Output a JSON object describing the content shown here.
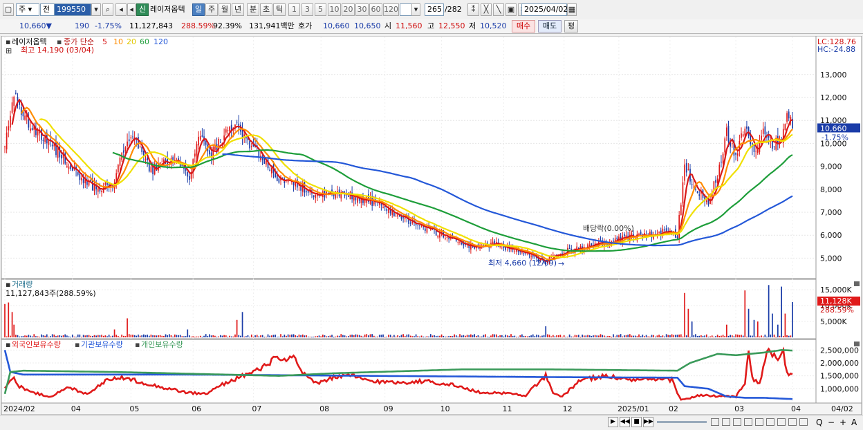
{
  "toolbar": {
    "market_label": "주",
    "compare_label": "전",
    "code_value": "199550",
    "badge_new": "신",
    "stock_name": "레이저옵텍",
    "periods": [
      "일",
      "주",
      "월",
      "년",
      "분",
      "초",
      "틱"
    ],
    "selected_period": "일",
    "intervals": [
      "1",
      "3",
      "5",
      "10",
      "20",
      "30",
      "60",
      "120"
    ],
    "count_value": "265",
    "count_total": "/282",
    "date_value": "2025/04/02"
  },
  "quote": {
    "price": "10,660",
    "arrow": "▼",
    "change": "190",
    "change_pct": "-1.75%",
    "volume": "11,127,843",
    "vol_ratio": "288.59%",
    "turnover": "92.39%",
    "amount": "131,941백만",
    "ask_label": "호가",
    "ask_price": "10,660",
    "bid_price": "10,650",
    "open_label": "시",
    "open_price": "11,560",
    "high_label": "고",
    "high_price": "12,550",
    "low_label": "저",
    "low_price": "10,520",
    "buy_label": "매수",
    "sell_label": "매도",
    "eval_label": "평"
  },
  "chart_data": {
    "type": "candlestick",
    "price_panel": {
      "title": "레이저옵텍",
      "ma_label": "종가 단순",
      "ma_periods": [
        "5",
        "10",
        "20",
        "60",
        "120"
      ],
      "ma_colors": [
        "#d81818",
        "#ff8c00",
        "#f0e000",
        "#1e9e3a",
        "#2458d8"
      ],
      "high_note": "최고 14,190 (03/04)",
      "low_note": "최저 4,660 (12/09)",
      "dividend_note": "배당락(0.00%)",
      "lc_label": "LC:128.76",
      "hc_label": "HC:-24.88",
      "y_ticks": [
        5000,
        6000,
        7000,
        8000,
        9000,
        10000,
        11000,
        12000,
        13000
      ],
      "y_tick_labels": [
        "5,000",
        "6,000",
        "7,000",
        "8,000",
        "9,000",
        "10,000",
        "11,000",
        "12,000",
        "13,000"
      ],
      "ylim": [
        4200,
        14500
      ],
      "current_price_label": "10,660",
      "current_change_label": "-1.75%",
      "current_price": 10660,
      "close_anchors": [
        [
          0,
          9800
        ],
        [
          5,
          12300
        ],
        [
          10,
          11200
        ],
        [
          20,
          10300
        ],
        [
          30,
          9600
        ],
        [
          40,
          8600
        ],
        [
          50,
          8000
        ],
        [
          60,
          8300
        ],
        [
          67,
          10300
        ],
        [
          72,
          10000
        ],
        [
          80,
          8800
        ],
        [
          88,
          9300
        ],
        [
          95,
          9000
        ],
        [
          101,
          8600
        ],
        [
          107,
          10400
        ],
        [
          112,
          9400
        ],
        [
          120,
          10300
        ],
        [
          127,
          10700
        ],
        [
          131,
          10200
        ],
        [
          136,
          9900
        ],
        [
          145,
          8900
        ],
        [
          152,
          8300
        ],
        [
          160,
          8200
        ],
        [
          172,
          7700
        ],
        [
          180,
          7800
        ],
        [
          190,
          7700
        ],
        [
          200,
          7500
        ],
        [
          215,
          6900
        ],
        [
          230,
          6300
        ],
        [
          240,
          6000
        ],
        [
          255,
          5500
        ],
        [
          270,
          5600
        ],
        [
          285,
          5200
        ],
        [
          295,
          4800
        ],
        [
          305,
          5300
        ],
        [
          315,
          5400
        ],
        [
          325,
          5600
        ],
        [
          335,
          5800
        ],
        [
          345,
          6000
        ],
        [
          355,
          6000
        ],
        [
          362,
          6200
        ],
        [
          368,
          6000
        ],
        [
          372,
          9000
        ],
        [
          378,
          8000
        ],
        [
          385,
          7500
        ],
        [
          390,
          8600
        ],
        [
          395,
          10500
        ],
        [
          400,
          9500
        ],
        [
          405,
          10800
        ],
        [
          410,
          9600
        ],
        [
          415,
          10500
        ],
        [
          420,
          10000
        ],
        [
          425,
          10300
        ],
        [
          429,
          11300
        ],
        [
          431,
          10660
        ]
      ],
      "n_days": 432,
      "seed": 199550
    },
    "volume_panel": {
      "title": "거래량",
      "current_label": "11,127,843주(288.59%)",
      "y_ticks": [
        5000000,
        10000000,
        15000000
      ],
      "y_tick_labels": [
        "5,000K",
        "10,000K",
        "15,000K"
      ],
      "ylim": [
        0,
        17000000
      ],
      "current_badge": "11,128K",
      "current_pct": "288.59%",
      "spikes": [
        [
          0,
          10500000
        ],
        [
          2,
          11000000
        ],
        [
          4,
          8000000
        ],
        [
          5,
          4000000
        ],
        [
          60,
          2500000
        ],
        [
          67,
          6000000
        ],
        [
          100,
          2500000
        ],
        [
          127,
          5500000
        ],
        [
          130,
          8000000
        ],
        [
          296,
          3500000
        ],
        [
          372,
          14000000
        ],
        [
          374,
          9000000
        ],
        [
          376,
          5000000
        ],
        [
          395,
          4000000
        ],
        [
          405,
          14800000
        ],
        [
          407,
          9000000
        ],
        [
          410,
          5500000
        ],
        [
          412,
          5000000
        ],
        [
          418,
          16500000
        ],
        [
          420,
          7500000
        ],
        [
          423,
          4000000
        ],
        [
          425,
          16000000
        ],
        [
          427,
          7500000
        ],
        [
          431,
          11127843
        ]
      ]
    },
    "holding_panel": {
      "series": [
        {
          "name": "외국인보유수량",
          "color": "#e01a1a",
          "points": [
            [
              0,
              1000000
            ],
            [
              4,
              1450000
            ],
            [
              8,
              1100000
            ],
            [
              15,
              850000
            ],
            [
              25,
              700000
            ],
            [
              35,
              1050000
            ],
            [
              45,
              800000
            ],
            [
              55,
              1300000
            ],
            [
              60,
              1450000
            ],
            [
              70,
              1350000
            ],
            [
              80,
              1150000
            ],
            [
              90,
              1000000
            ],
            [
              100,
              850000
            ],
            [
              110,
              800000
            ],
            [
              120,
              1200000
            ],
            [
              130,
              1500000
            ],
            [
              140,
              1750000
            ],
            [
              148,
              2200000
            ],
            [
              152,
              2050000
            ],
            [
              158,
              2200000
            ],
            [
              162,
              1700000
            ],
            [
              170,
              1200000
            ],
            [
              180,
              1450000
            ],
            [
              190,
              1500000
            ],
            [
              200,
              1300000
            ],
            [
              210,
              1250000
            ],
            [
              220,
              1250000
            ],
            [
              230,
              1300000
            ],
            [
              245,
              1150000
            ],
            [
              260,
              850000
            ],
            [
              270,
              850000
            ],
            [
              285,
              750000
            ],
            [
              296,
              1500000
            ],
            [
              300,
              800000
            ],
            [
              305,
              700000
            ],
            [
              315,
              1350000
            ],
            [
              330,
              1500000
            ],
            [
              340,
              1350000
            ],
            [
              355,
              1350000
            ],
            [
              365,
              1350000
            ],
            [
              370,
              550000
            ],
            [
              380,
              750000
            ],
            [
              390,
              700000
            ],
            [
              400,
              700000
            ],
            [
              405,
              1200000
            ],
            [
              407,
              2550000
            ],
            [
              409,
              1400000
            ],
            [
              413,
              1150000
            ],
            [
              415,
              1900000
            ],
            [
              418,
              2550000
            ],
            [
              420,
              2300000
            ],
            [
              423,
              2150000
            ],
            [
              426,
              2400000
            ],
            [
              428,
              1600000
            ],
            [
              431,
              1550000
            ]
          ]
        },
        {
          "name": "기관보유수량",
          "color": "#2458d8",
          "points": [
            [
              0,
              2500000
            ],
            [
              3,
              1650000
            ],
            [
              10,
              1550000
            ],
            [
              100,
              1550000
            ],
            [
              200,
              1500000
            ],
            [
              300,
              1450000
            ],
            [
              368,
              1430000
            ],
            [
              372,
              1100000
            ],
            [
              385,
              1000000
            ],
            [
              395,
              700000
            ],
            [
              405,
              650000
            ],
            [
              415,
              650000
            ],
            [
              431,
              600000
            ]
          ]
        },
        {
          "name": "개인보유수량",
          "color": "#3a9a5a",
          "points": [
            [
              0,
              800000
            ],
            [
              3,
              1650000
            ],
            [
              10,
              1700000
            ],
            [
              60,
              1650000
            ],
            [
              150,
              1500000
            ],
            [
              180,
              1600000
            ],
            [
              250,
              1750000
            ],
            [
              300,
              1750000
            ],
            [
              368,
              1700000
            ],
            [
              375,
              2000000
            ],
            [
              390,
              2350000
            ],
            [
              400,
              2300000
            ],
            [
              415,
              2400000
            ],
            [
              425,
              2500000
            ],
            [
              431,
              2480000
            ]
          ]
        }
      ],
      "y_ticks": [
        1000000,
        1500000,
        2000000,
        2500000
      ],
      "y_tick_labels": [
        "1,000,000",
        "1,500,000",
        "2,000,000",
        "2,500,000"
      ],
      "ylim": [
        500000,
        2750000
      ]
    },
    "x_axis": {
      "labels": [
        [
          "2024/02",
          0
        ],
        [
          "04",
          37
        ],
        [
          "05",
          69
        ],
        [
          "06",
          103
        ],
        [
          "07",
          136
        ],
        [
          "08",
          173
        ],
        [
          "09",
          208
        ],
        [
          "10",
          239
        ],
        [
          "11",
          273
        ],
        [
          "12",
          306
        ],
        [
          "2025/01",
          336
        ],
        [
          "02",
          364
        ],
        [
          "03",
          400
        ],
        [
          "04",
          431
        ]
      ],
      "end_label": "04/02"
    }
  },
  "bottom": {
    "controls": [
      "▶",
      "◀◀",
      "■",
      "▶▶"
    ],
    "zoom_controls": [
      "Q",
      "−",
      "+",
      "A"
    ]
  }
}
